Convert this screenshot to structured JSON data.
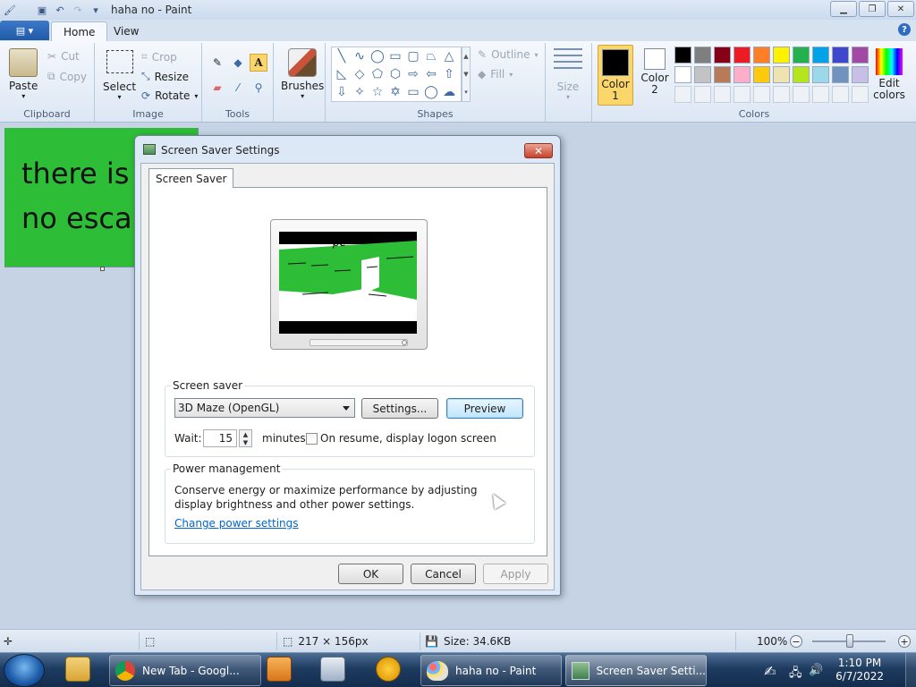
{
  "window": {
    "title": "haha no - Paint",
    "controls": [
      "minimize",
      "maximize",
      "close"
    ]
  },
  "ribbon": {
    "tabs": [
      "Home",
      "View"
    ],
    "active_tab": "Home",
    "clipboard": {
      "paste": "Paste",
      "cut": "Cut",
      "copy": "Copy",
      "label": "Clipboard"
    },
    "image": {
      "select": "Select",
      "crop": "Crop",
      "resize": "Resize",
      "rotate": "Rotate",
      "label": "Image"
    },
    "tools": {
      "label": "Tools",
      "selected": "text-tool"
    },
    "brushes": {
      "label": "Brushes"
    },
    "shapes": {
      "label": "Shapes",
      "outline": "Outline",
      "fill": "Fill"
    },
    "size": {
      "label": "Size"
    },
    "color1": {
      "label1": "Color",
      "label2": "1",
      "value": "#000000"
    },
    "color2": {
      "label1": "Color",
      "label2": "2",
      "value": "#ffffff"
    },
    "colors": {
      "label": "Colors",
      "edit_label1": "Edit",
      "edit_label2": "colors",
      "palette_row1": [
        "#000000",
        "#7f7f7f",
        "#880015",
        "#ed1c24",
        "#ff7f27",
        "#fff200",
        "#22b14c",
        "#00a2e8",
        "#3f48cc",
        "#a349a4"
      ],
      "palette_row2": [
        "#ffffff",
        "#c3c3c3",
        "#b97a57",
        "#ffaec9",
        "#ffc90e",
        "#efe4b0",
        "#b5e61d",
        "#99d9ea",
        "#7092be",
        "#c8bfe7"
      ]
    }
  },
  "canvas": {
    "background": "#2ebd36",
    "text_line1": "there is",
    "text_line2": "no escape"
  },
  "statusbar": {
    "dimensions": "217 × 156px",
    "size": "Size: 34.6KB",
    "zoom": "100%",
    "zoom_minus": "−",
    "zoom_plus": "+"
  },
  "dialog": {
    "title": "Screen Saver Settings",
    "close": "✕",
    "tab": "Screen Saver",
    "preview_text": "pe",
    "screensaver_legend": "Screen saver",
    "screensaver_selected": "3D Maze (OpenGL)",
    "settings_button": "Settings...",
    "preview_button": "Preview",
    "wait_label": "Wait:",
    "wait_value": "15",
    "minutes_label": "minutes",
    "resume_label": "On resume, display logon screen",
    "resume_checked": false,
    "power_legend": "Power management",
    "power_text": "Conserve energy or maximize performance by adjusting display brightness and other power settings.",
    "power_link": "Change power settings",
    "ok": "OK",
    "cancel": "Cancel",
    "apply": "Apply"
  },
  "taskbar": {
    "items": [
      {
        "label": "New Tab - Googl...",
        "icon": "chrome-icon"
      },
      {
        "label": "haha no - Paint",
        "icon": "paint-icon"
      },
      {
        "label": "Screen Saver Setti...",
        "icon": "screensaver-icon",
        "active": true
      }
    ],
    "time": "1:10 PM",
    "date": "6/7/2022"
  }
}
